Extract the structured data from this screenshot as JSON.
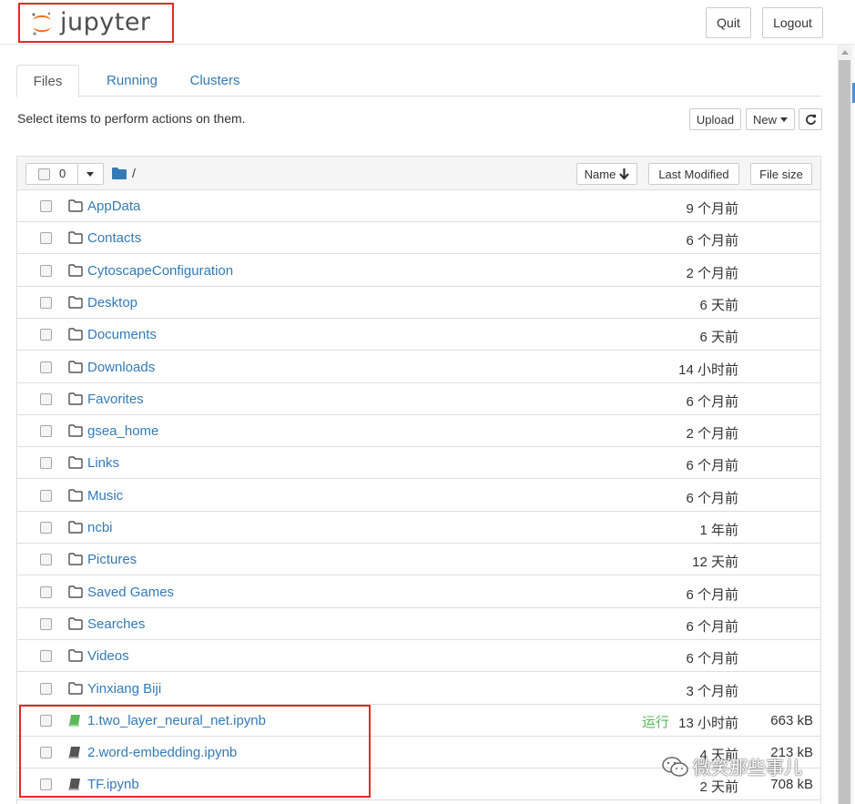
{
  "header": {
    "logo_text": "jupyter",
    "quit_label": "Quit",
    "logout_label": "Logout"
  },
  "tabs": [
    {
      "label": "Files",
      "active": true
    },
    {
      "label": "Running",
      "active": false
    },
    {
      "label": "Clusters",
      "active": false
    }
  ],
  "toolbar": {
    "hint": "Select items to perform actions on them.",
    "upload_label": "Upload",
    "new_label": "New"
  },
  "list_header": {
    "selected_count": "0",
    "breadcrumb": "/",
    "name_label": "Name",
    "modified_label": "Last Modified",
    "size_label": "File size"
  },
  "items": [
    {
      "type": "folder",
      "name": "AppData",
      "modified": "9 个月前",
      "size": ""
    },
    {
      "type": "folder",
      "name": "Contacts",
      "modified": "6 个月前",
      "size": ""
    },
    {
      "type": "folder",
      "name": "CytoscapeConfiguration",
      "modified": "2 个月前",
      "size": ""
    },
    {
      "type": "folder",
      "name": "Desktop",
      "modified": "6 天前",
      "size": ""
    },
    {
      "type": "folder",
      "name": "Documents",
      "modified": "6 天前",
      "size": ""
    },
    {
      "type": "folder",
      "name": "Downloads",
      "modified": "14 小时前",
      "size": ""
    },
    {
      "type": "folder",
      "name": "Favorites",
      "modified": "6 个月前",
      "size": ""
    },
    {
      "type": "folder",
      "name": "gsea_home",
      "modified": "2 个月前",
      "size": ""
    },
    {
      "type": "folder",
      "name": "Links",
      "modified": "6 个月前",
      "size": ""
    },
    {
      "type": "folder",
      "name": "Music",
      "modified": "6 个月前",
      "size": ""
    },
    {
      "type": "folder",
      "name": "ncbi",
      "modified": "1 年前",
      "size": ""
    },
    {
      "type": "folder",
      "name": "Pictures",
      "modified": "12 天前",
      "size": ""
    },
    {
      "type": "folder",
      "name": "Saved Games",
      "modified": "6 个月前",
      "size": ""
    },
    {
      "type": "folder",
      "name": "Searches",
      "modified": "6 个月前",
      "size": ""
    },
    {
      "type": "folder",
      "name": "Videos",
      "modified": "6 个月前",
      "size": ""
    },
    {
      "type": "folder",
      "name": "Yinxiang Biji",
      "modified": "3 个月前",
      "size": ""
    },
    {
      "type": "notebook-running",
      "name": "1.two_layer_neural_net.ipynb",
      "running": "运行",
      "modified": "13 小时前",
      "size": "663 kB"
    },
    {
      "type": "notebook",
      "name": "2.word-embedding.ipynb",
      "modified": "4 天前",
      "size": "213 kB"
    },
    {
      "type": "notebook",
      "name": "TF.ipynb",
      "modified": "2 天前",
      "size": "708 kB"
    }
  ],
  "watermark": "微笑那些事儿",
  "colors": {
    "link": "#337ab7",
    "running": "#5cb85c",
    "highlight": "#e02a2a",
    "logo_orange": "#f37726"
  }
}
